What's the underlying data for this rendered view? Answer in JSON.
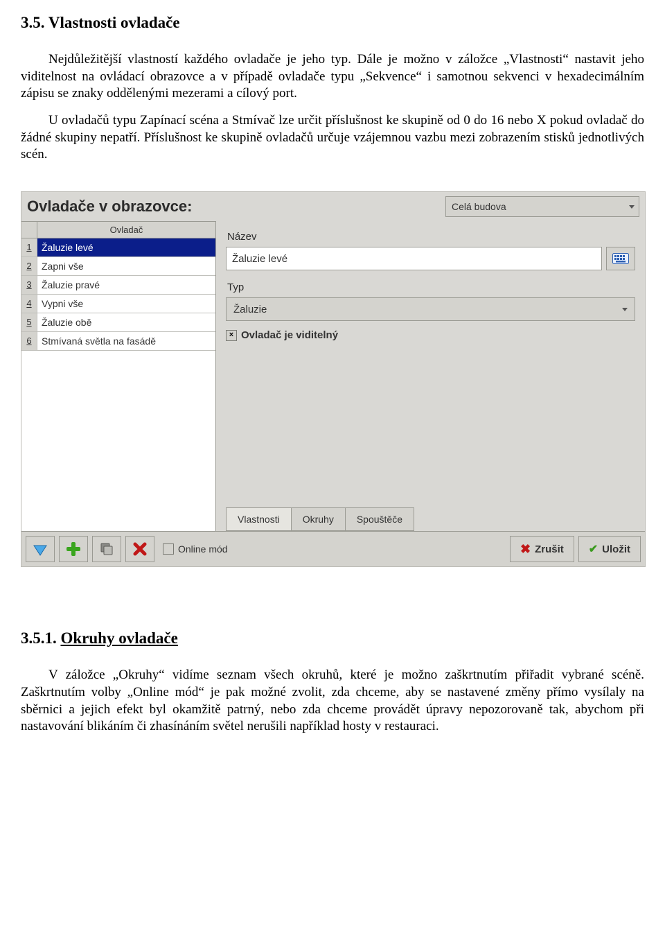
{
  "doc": {
    "heading": "3.5.  Vlastnosti ovladače",
    "para1": "Nejdůležitější vlastností každého ovladače je jeho typ. Dále je možno v záložce „Vlastnosti“ nastavit jeho viditelnost na ovládací obrazovce a v případě ovladače typu „Sekvence“ i samotnou sekvenci v hexadecimálním zápisu se znaky oddělenými mezerami a cílový port.",
    "para2": "U ovladačů typu Zapínací scéna a Stmívač lze určit příslušnost ke skupině od 0 do 16 nebo X pokud ovladač do žádné skupiny nepatří. Příslušnost ke skupině ovladačů určuje vzájemnou vazbu mezi zobrazením stisků jednotlivých scén.",
    "sub_heading_num": "3.5.1.",
    "sub_heading_text": "Okruhy ovladače",
    "para3": "V záložce „Okruhy“ vidíme seznam všech okruhů, které je možno zaškrtnutím přiřadit vybrané scéně. Zaškrtnutím volby „Online mód“ je pak možné zvolit, zda chceme, aby se nastavené změny přímo vysílaly na sběrnici a jejich efekt byl okamžitě patrný, nebo zda chceme provádět úpravy nepozorovaně tak, abychom při nastavování blikáním či zhasínáním světel nerušili například hosty v restauraci."
  },
  "ui": {
    "title": "Ovladače v obrazovce:",
    "scope": "Celá budova",
    "list": {
      "col_label": "Ovladač",
      "rows": [
        {
          "n": "1",
          "label": "Žaluzie levé",
          "selected": true
        },
        {
          "n": "2",
          "label": "Zapni vše",
          "selected": false
        },
        {
          "n": "3",
          "label": "Žaluzie pravé",
          "selected": false
        },
        {
          "n": "4",
          "label": "Vypni vše",
          "selected": false
        },
        {
          "n": "5",
          "label": "Žaluzie obě",
          "selected": false
        },
        {
          "n": "6",
          "label": "Stmívaná světla na fasádě",
          "selected": false
        }
      ]
    },
    "form": {
      "name_label": "Název",
      "name_value": "Žaluzie levé",
      "type_label": "Typ",
      "type_value": "Žaluzie",
      "visible_label": "Ovladač je viditelný"
    },
    "tabs": {
      "t1": "Vlastnosti",
      "t2": "Okruhy",
      "t3": "Spouštěče"
    },
    "footer": {
      "online": "Online mód",
      "cancel": "Zrušit",
      "save": "Uložit"
    }
  }
}
